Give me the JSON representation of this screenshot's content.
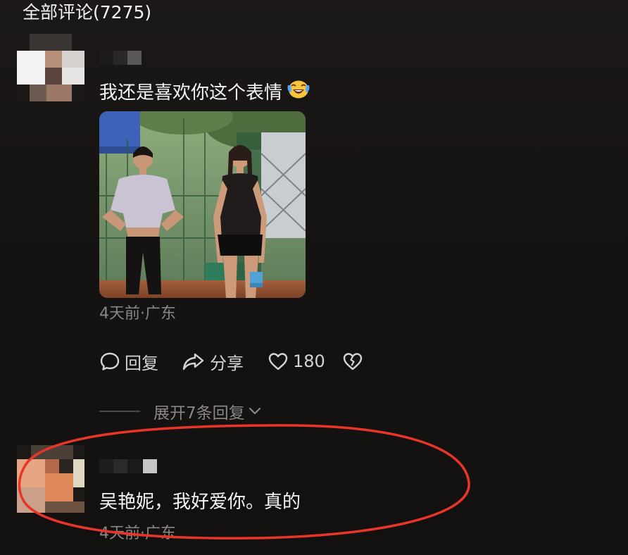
{
  "header": {
    "title": "全部评论(7275)"
  },
  "comments": [
    {
      "text": "我还是喜欢你这个表情",
      "emoji": "laughing-crying-emoji",
      "time_location": "4天前·广东",
      "actions": {
        "reply_label": "回复",
        "share_label": "分享",
        "like_count": "180"
      },
      "expand_label": "展开7条回复"
    },
    {
      "text": "吴艳妮，我好爱你。真的",
      "time_location": "4天前·广东"
    }
  ],
  "colors": {
    "background": "#151312",
    "text_primary": "#f4f4f4",
    "text_secondary": "#8a8685",
    "highlight": "#e8352a"
  }
}
